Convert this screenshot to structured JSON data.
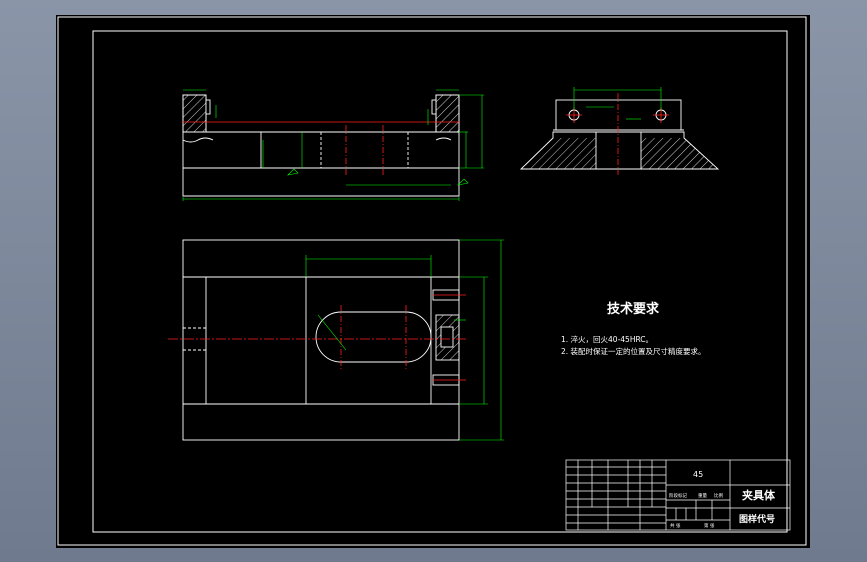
{
  "technical_requirements": {
    "title": "技术要求",
    "items": [
      "1. 淬火，回火40-45HRC。",
      "2. 装配时保证一定的位置及尺寸精度要求。"
    ]
  },
  "title_block": {
    "material": "45",
    "part_name": "夹具体",
    "drawing_code": "图样代号",
    "labels": {
      "stage_mark": "阶段标记",
      "weight": "重量",
      "scale": "比例",
      "total_sheets": "共 张",
      "sheet_no": "第 张"
    }
  }
}
